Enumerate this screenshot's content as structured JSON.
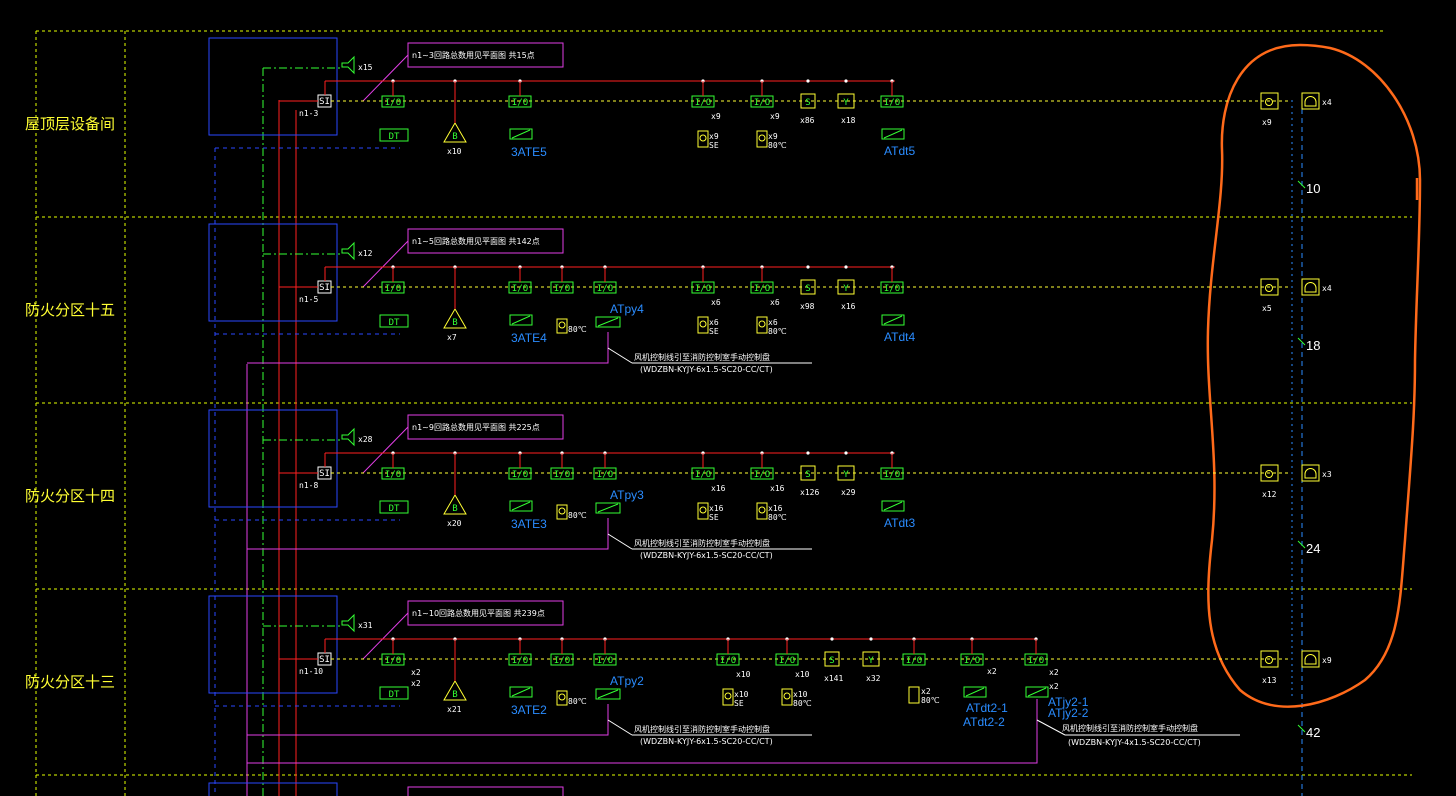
{
  "zones": [
    {
      "label": "屋顶层设备间",
      "loop": "n1-3",
      "loop_note": "n1~3回路总数用见平面图    共15点",
      "speaker": "x15",
      "blocks": [
        {
          "type": "dt",
          "io": "I/O",
          "label": "DT"
        },
        {
          "type": "bell",
          "io": "",
          "qty": "x10"
        },
        {
          "type": "module",
          "io": "I/O",
          "label": "3ATE5"
        },
        {
          "type": "smoke",
          "io": "I/O",
          "qty": "x9",
          "sub": "SE"
        },
        {
          "type": "heat",
          "io": "I/O",
          "qty": "x9",
          "sub": "80℃"
        },
        {
          "type": "s",
          "qty": "x86"
        },
        {
          "type": "y",
          "qty": "x18"
        },
        {
          "type": "module",
          "io": "I/O",
          "label": "ATdt5"
        }
      ],
      "right": {
        "qty_a": "x9",
        "qty_b": "x4",
        "count": "10"
      }
    },
    {
      "label": "防火分区十五",
      "loop": "n1-5",
      "loop_note": "n1~5回路总数用见平面图    共142点",
      "speaker": "x12",
      "bell_qty": "x7",
      "module_label": "3ATE4",
      "py_label": "ATpy4",
      "smoke_qty": "x6",
      "heat_qty": "x6",
      "s_qty": "x98",
      "y_qty": "x16",
      "dt_label": "ATdt4",
      "note1": "风机控制线引至消防控制室手动控制盘",
      "note2": "(WDZBN-KYJY-6x1.5-SC20-CC/CT)",
      "right": {
        "qty_a": "x5",
        "qty_b": "x4",
        "count": "18"
      }
    },
    {
      "label": "防火分区十四",
      "loop": "n1-8",
      "loop_note": "n1~9回路总数用见平面图    共225点",
      "speaker": "x28",
      "bell_qty": "x20",
      "module_label": "3ATE3",
      "py_label": "ATpy3",
      "smoke_qty": "x16",
      "heat_qty": "x16",
      "s_qty": "x126",
      "y_qty": "x29",
      "dt_label": "ATdt3",
      "note1": "风机控制线引至消防控制室手动控制盘",
      "note2": "(WDZBN-KYJY-6x1.5-SC20-CC/CT)",
      "right": {
        "qty_a": "x12",
        "qty_b": "x3",
        "count": "24"
      }
    },
    {
      "label": "防火分区十三",
      "loop": "n1-10",
      "loop_note": "n1~10回路总数用见平面图    共239点",
      "speaker": "x31",
      "bell_qty": "x21",
      "module_label": "3ATE2",
      "py_label": "ATpy2",
      "smoke_qty": "x10",
      "heat_qty": "x10",
      "s_qty": "x141",
      "y_qty": "x32",
      "extra_qty": "x2",
      "dt_label1": "ATdt2-1",
      "dt_label2": "ATdt2-2",
      "jy_label1": "ATjy2-1",
      "jy_label2": "ATjy2-2",
      "note1": "风机控制线引至消防控制室手动控制盘",
      "note2": "(WDZBN-KYJY-6x1.5-SC20-CC/CT)",
      "note3": "风机控制线引至消防控制室手动控制盘",
      "note4": "(WDZBN-KYJY-4x1.5-SC20-CC/CT)",
      "right": {
        "qty_a": "x13",
        "qty_b": "x9",
        "count": "42"
      }
    }
  ],
  "common": {
    "io": "I/O",
    "dt": "DT",
    "si": "SI",
    "temp": "80℃",
    "se": "SE",
    "x2": "x2"
  },
  "colors": {
    "grid": "#e5ff00",
    "bus": "#ff2020",
    "device": "#33ff33",
    "fixture": "#ffff33",
    "wire_blue": "#2a48ff",
    "wire_magenta": "#e23ee6",
    "annotation": "#ff6a1a"
  }
}
